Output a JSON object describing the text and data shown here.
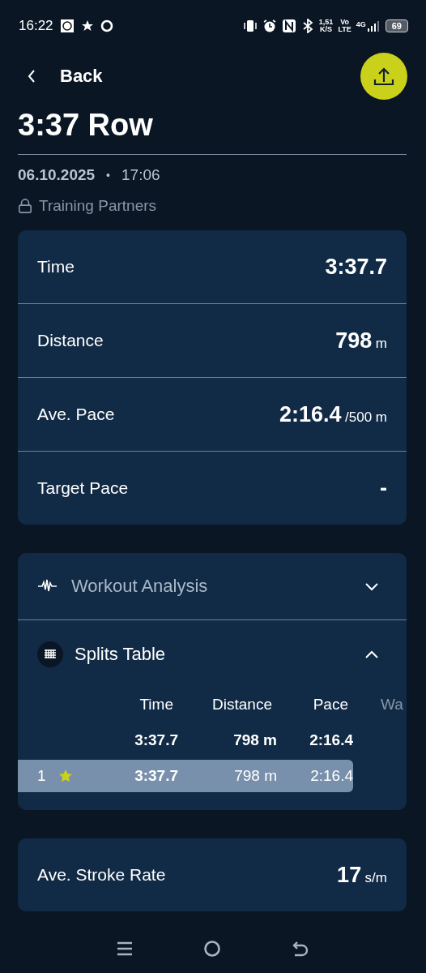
{
  "status_bar": {
    "time": "16:22",
    "net_speed": "1,51",
    "net_speed_unit": "K/S",
    "volte_top": "Vo",
    "volte_bottom": "LTE",
    "network": "4G",
    "battery": "69"
  },
  "header": {
    "back_label": "Back"
  },
  "title": "3:37 Row",
  "date": "06.10.2025",
  "separator": "•",
  "time": "17:06",
  "visibility": "Training Partners",
  "metrics": [
    {
      "label": "Time",
      "value": "3:37.7"
    },
    {
      "label": "Distance",
      "value": "798",
      "unit": "m"
    },
    {
      "label": "Ave. Pace",
      "value": "2:16.4",
      "unit": "/500 m"
    },
    {
      "label": "Target Pace",
      "value": "-"
    }
  ],
  "sections": [
    {
      "kind": "analysis",
      "title": "Workout Analysis",
      "expanded": false
    },
    {
      "kind": "splits",
      "title": "Splits Table",
      "expanded": true
    }
  ],
  "splits_table": {
    "columns": [
      "Time",
      "Distance",
      "Pace",
      "Wa"
    ],
    "total": [
      "3:37.7",
      "798 m",
      "2:16.4"
    ],
    "rows": [
      {
        "index": "1",
        "starred": true,
        "selected": true,
        "cells": [
          "3:37.7",
          "798 m",
          "2:16.4"
        ]
      }
    ]
  },
  "extra_metrics": [
    {
      "label": "Ave. Stroke Rate",
      "value": "17",
      "unit": "s/m"
    }
  ]
}
